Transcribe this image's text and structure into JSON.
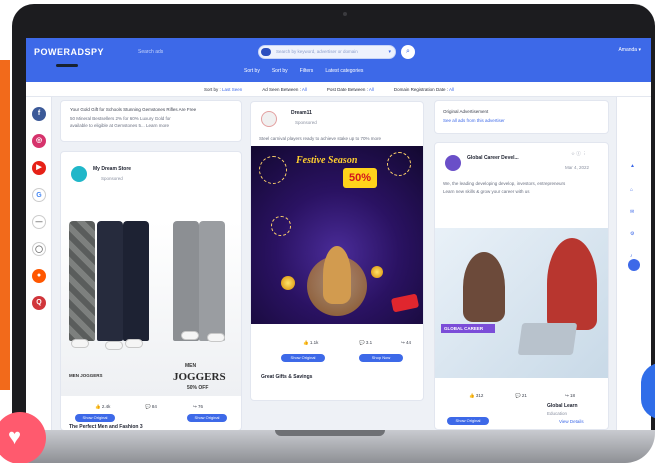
{
  "app": {
    "logo_text": "POWERADSPY",
    "top_search_hint": "Search ads",
    "search_placeholder": "Search by keyword, advertiser or domain",
    "search_icon": "search-icon",
    "account_label": "Amanda",
    "brand_color": "#3d69e8"
  },
  "top_menu": [
    "Sort by",
    "Sort by",
    "Filters",
    "Latest categories"
  ],
  "filters": [
    {
      "label": "Sort by :",
      "value": "Last Seen"
    },
    {
      "label": "Ad Seen Between :",
      "value": "All"
    },
    {
      "label": "Post Date Between :",
      "value": "All"
    },
    {
      "label": "Domain Registration Date :",
      "value": "All"
    }
  ],
  "left_rail_icons": [
    {
      "name": "facebook-icon",
      "glyph": "f",
      "color": "#3b5998"
    },
    {
      "name": "instagram-icon",
      "glyph": "◎",
      "color": "#d6336c"
    },
    {
      "name": "youtube-icon",
      "glyph": "▶",
      "color": "#e62117"
    },
    {
      "name": "google-icon",
      "glyph": "G",
      "color": "#ffffff"
    },
    {
      "name": "native-icon",
      "glyph": "—",
      "color": "#ffffff"
    },
    {
      "name": "gdn-icon",
      "glyph": "◯",
      "color": "#ffffff"
    },
    {
      "name": "reddit-icon",
      "glyph": "●",
      "color": "#ff5700"
    },
    {
      "name": "quora-icon",
      "glyph": "Q",
      "color": "#d0363b"
    }
  ],
  "cards": {
    "left_top": {
      "title": "Your Gold Gift for Schools Stunning Gemstones Rifles Are Free",
      "line1": "50 Mineral Bestsellers 2% for 60% Luxury Gold for",
      "line2": "available to eligible at Gemstones 5... Learn more"
    },
    "joggers": {
      "page_name": "My Dream Store",
      "sponsored": "Sponsored",
      "banner_left": "MEN JOGGERS",
      "banner_sub": "MEN",
      "banner_title": "JOGGERS",
      "banner_off": "50% OFF",
      "stats": [
        "2.4k",
        "84",
        "76"
      ],
      "btn_left": "Show Original",
      "btn_right": "Show Original",
      "footer_title": "The Perfect Men and Fashion 3",
      "footer_line": "Shop the best joggers from the store at better price"
    },
    "game": {
      "page_name": "Dream11",
      "sponsored": "Sponsored",
      "caption": "Steel carnival players ready to achieve stake up to 70% more",
      "promo_title": "Festive Season",
      "promo_pct": "50%",
      "stats": [
        "1.1k",
        "3.1",
        "44"
      ],
      "btn_left": "Show Original",
      "btn_right": "Shop Now",
      "footer": "Great Gifts & Savings"
    },
    "right_top": {
      "title": "Original Advertisement",
      "link": "See all ads from this advertiser"
    },
    "office": {
      "page_name": "Global Career Devel...",
      "date": "Mar 4, 2022",
      "line1": "We, the leading developing develop, investors, entrepreneurs",
      "line2": "Learn new skills & grow your career with us",
      "banner": "GLOBAL CAREER",
      "brand": "Global Learn",
      "brand_sub": "Education",
      "stats": [
        "312",
        "21",
        "18"
      ],
      "btn_left": "Show Original",
      "btn_right": "View Details",
      "footer": "Upgrade Your Career Expertise"
    }
  },
  "right_rail_icons": [
    "arrow-up-icon",
    "home-icon",
    "chat-icon",
    "settings-icon",
    "bell-icon"
  ]
}
